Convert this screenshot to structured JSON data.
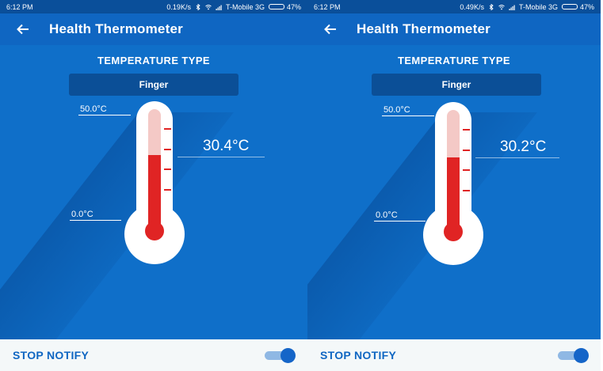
{
  "screens": [
    {
      "status": {
        "time": "6:12 PM",
        "speed": "0.19K/s",
        "carrier": "T-Mobile 3G",
        "battery": "47%"
      },
      "appbar": {
        "title": "Health Thermometer"
      },
      "type_label": "TEMPERATURE TYPE",
      "type_value": "Finger",
      "scale_max": "50.0°C",
      "scale_min": "0.0°C",
      "reading": "30.4°C",
      "fill_fraction": 0.61,
      "stop_notify": "STOP NOTIFY",
      "toggle_on": true
    },
    {
      "status": {
        "time": "6:12 PM",
        "speed": "0.49K/s",
        "carrier": "T-Mobile 3G",
        "battery": "47%"
      },
      "appbar": {
        "title": "Health Thermometer"
      },
      "type_label": "TEMPERATURE TYPE",
      "type_value": "Finger",
      "scale_max": "50.0°C",
      "scale_min": "0.0°C",
      "reading": "30.2°C",
      "fill_fraction": 0.6,
      "stop_notify": "STOP NOTIFY",
      "toggle_on": true
    }
  ],
  "colors": {
    "statusbar": "#0a4f9a",
    "appbar": "#0f66c2",
    "background": "#0f6fc9",
    "mercury": "#e02424",
    "accent": "#0f66c2"
  },
  "icons": [
    "back-arrow-icon",
    "bluetooth-icon",
    "wifi-icon",
    "signal-icon",
    "battery-icon"
  ]
}
